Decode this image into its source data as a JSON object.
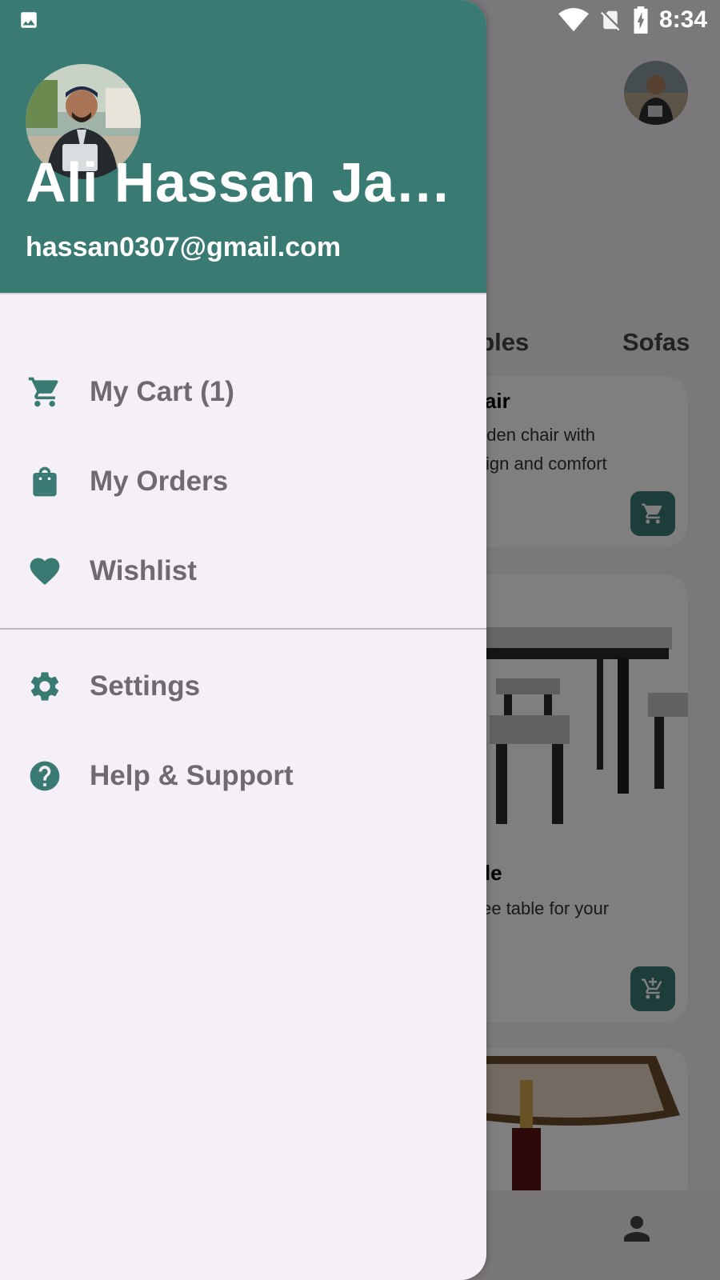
{
  "status_bar": {
    "time": "8:34"
  },
  "drawer": {
    "user_name": "Ali Hassan Jam…",
    "email": "hassan0307@gmail.com",
    "menu": [
      {
        "label": "My Cart (1)",
        "icon": "cart-icon"
      },
      {
        "label": "My Orders",
        "icon": "shopping-bag-icon"
      },
      {
        "label": "Wishlist",
        "icon": "heart-icon"
      },
      {
        "label": "Settings",
        "icon": "gear-icon"
      },
      {
        "label": "Help & Support",
        "icon": "help-icon"
      }
    ]
  },
  "background": {
    "tabs": [
      "ables",
      "Sofas"
    ],
    "cards": [
      {
        "title": "hair",
        "desc_line1": "oden chair with",
        "desc_line2": "sign and comfort"
      },
      {
        "title": "ble",
        "desc_line1": "fee table for your",
        "desc_line2": ""
      }
    ]
  },
  "colors": {
    "primary": "#397a72",
    "drawer_bg": "#f5f0f8",
    "label": "#6f6a72"
  }
}
